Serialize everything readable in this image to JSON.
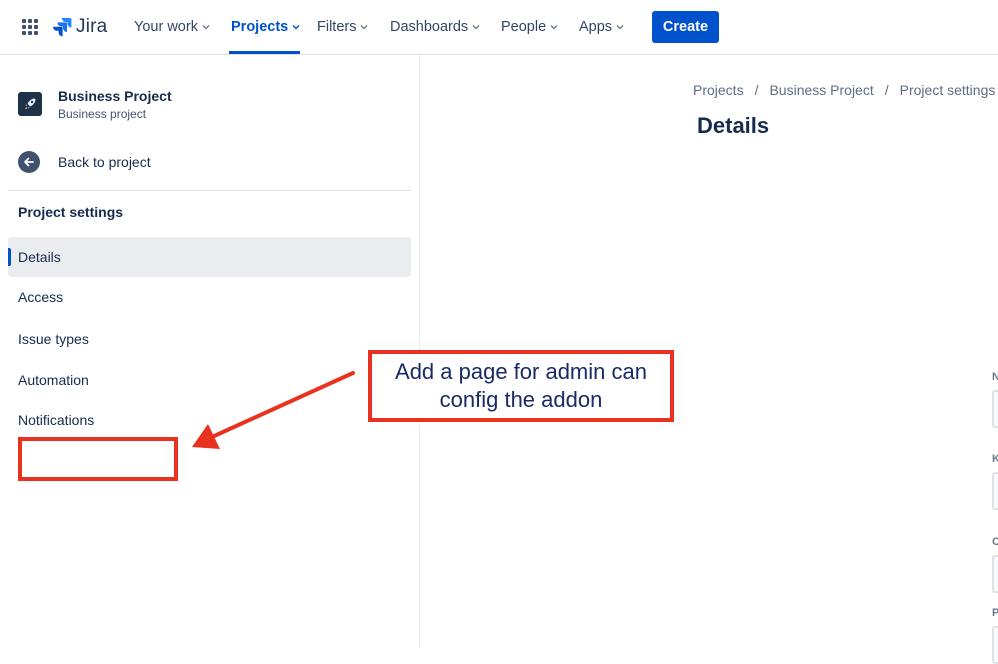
{
  "topnav": {
    "logo_text": "Jira",
    "items": [
      {
        "label": "Your work"
      },
      {
        "label": "Projects"
      },
      {
        "label": "Filters"
      },
      {
        "label": "Dashboards"
      },
      {
        "label": "People"
      },
      {
        "label": "Apps"
      }
    ],
    "create_label": "Create",
    "accent_color": "#0052cc"
  },
  "sidebar": {
    "project_name": "Business Project",
    "project_type": "Business project",
    "back_label": "Back to project",
    "heading": "Project settings",
    "items": [
      {
        "label": "Details",
        "selected": true
      },
      {
        "label": "Access"
      },
      {
        "label": "Issue types"
      },
      {
        "label": "Automation"
      },
      {
        "label": "Notifications"
      }
    ]
  },
  "main": {
    "breadcrumb": [
      "Projects",
      "Business Project",
      "Project settings"
    ],
    "breadcrumb_separator": "/",
    "title": "Details",
    "field_labels": [
      "N",
      "K",
      "C",
      "P"
    ]
  },
  "annotation": {
    "line1": "Add a page for admin can",
    "line2": "config the addon",
    "color": "#e8321f"
  }
}
